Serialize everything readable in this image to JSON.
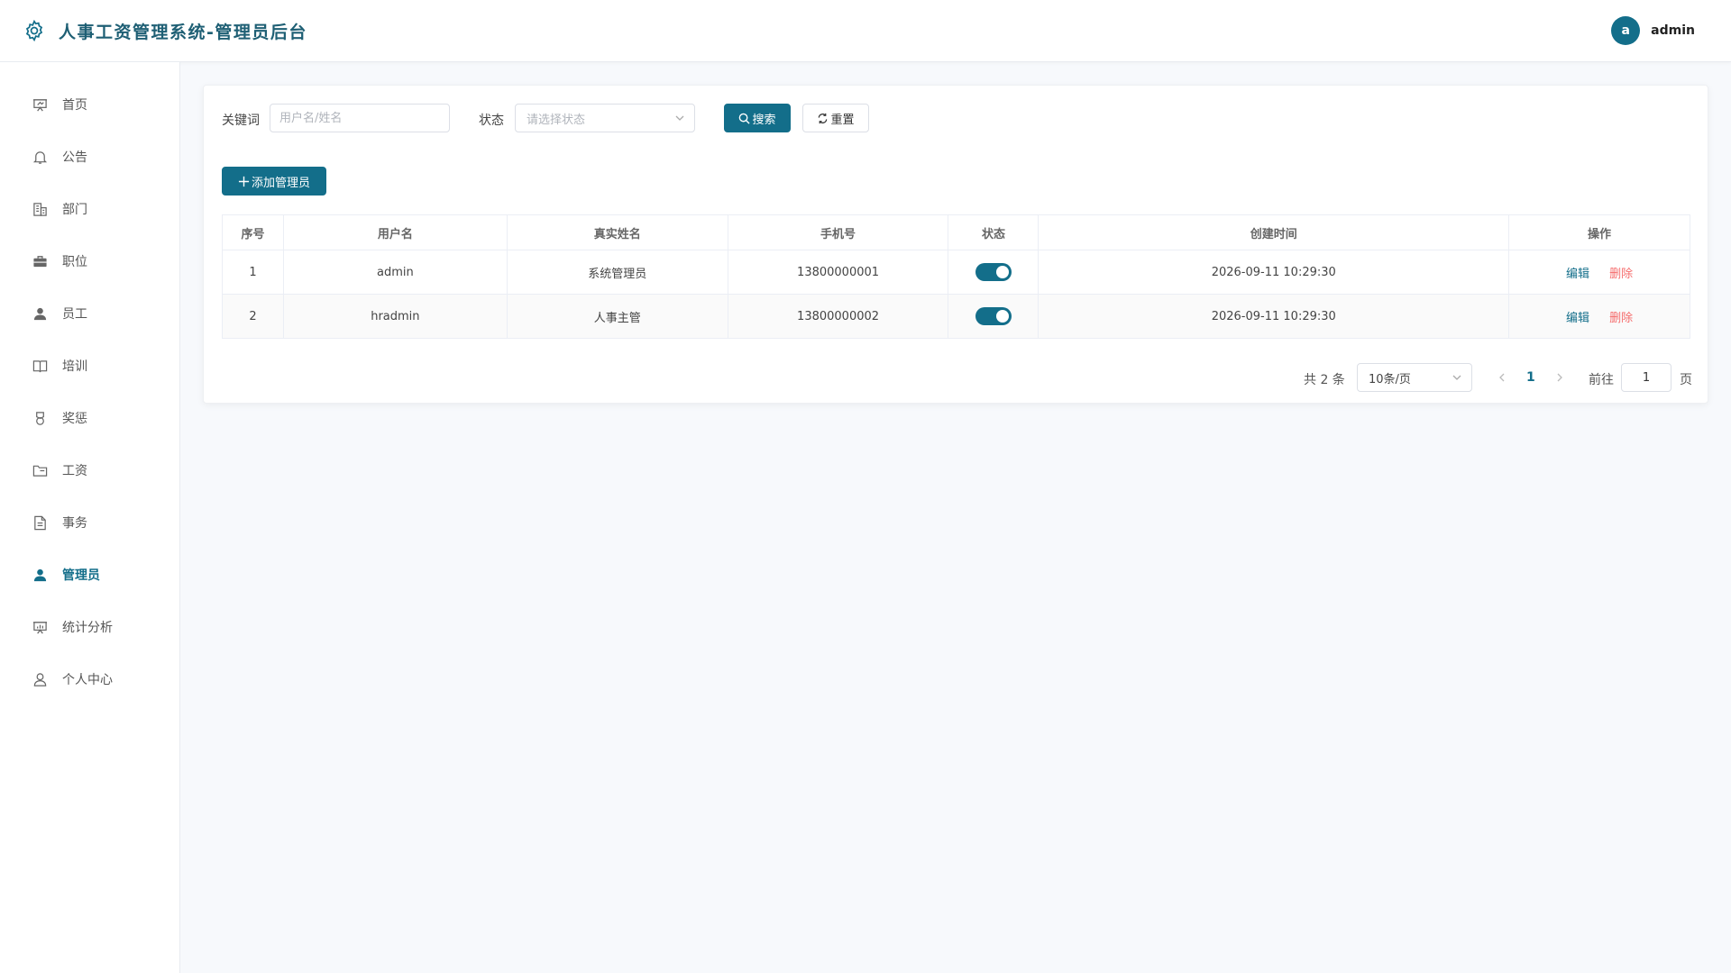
{
  "header": {
    "title": "人事工资管理系统-管理员后台",
    "user": {
      "avatar_letter": "a",
      "name": "admin"
    }
  },
  "colors": {
    "primary": "#136e8a",
    "danger": "#f56c6c",
    "title": "#1e5f74"
  },
  "sidebar": {
    "items": [
      {
        "label": "首页",
        "icon": "home-icon"
      },
      {
        "label": "公告",
        "icon": "bell-icon"
      },
      {
        "label": "部门",
        "icon": "building-icon"
      },
      {
        "label": "职位",
        "icon": "briefcase-icon"
      },
      {
        "label": "员工",
        "icon": "user-icon"
      },
      {
        "label": "培训",
        "icon": "book-icon"
      },
      {
        "label": "奖惩",
        "icon": "medal-icon"
      },
      {
        "label": "工资",
        "icon": "folder-icon"
      },
      {
        "label": "事务",
        "icon": "document-icon"
      },
      {
        "label": "管理员",
        "icon": "admin-user-icon",
        "active": true
      },
      {
        "label": "统计分析",
        "icon": "chart-board-icon"
      },
      {
        "label": "个人中心",
        "icon": "person-outline-icon"
      }
    ]
  },
  "filter": {
    "keyword_label": "关键词",
    "keyword_placeholder": "用户名/姓名",
    "keyword_value": "",
    "status_label": "状态",
    "status_placeholder": "请选择状态",
    "search_label": "搜索",
    "reset_label": "重置"
  },
  "add_button_label": "添加管理员",
  "table": {
    "columns": [
      "序号",
      "用户名",
      "真实姓名",
      "手机号",
      "状态",
      "创建时间",
      "操作"
    ],
    "rows": [
      {
        "index": "1",
        "username": "admin",
        "realname": "系统管理员",
        "phone": "13800000001",
        "enabled": true,
        "created": "2026-09-11 10:29:30"
      },
      {
        "index": "2",
        "username": "hradmin",
        "realname": "人事主管",
        "phone": "13800000002",
        "enabled": true,
        "created": "2026-09-11 10:29:30"
      }
    ],
    "edit_label": "编辑",
    "delete_label": "删除"
  },
  "pagination": {
    "total_text": "共 2 条",
    "page_size": "10条/页",
    "current_page": "1",
    "goto_label": "前往",
    "goto_value": "1",
    "page_suffix": "页"
  }
}
